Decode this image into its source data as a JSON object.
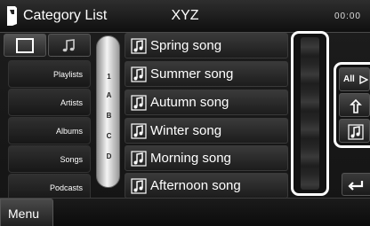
{
  "header": {
    "title": "Category List",
    "source": "XYZ",
    "clock": "00:00"
  },
  "mode_tabs": [
    {
      "icon": "list-view-icon"
    },
    {
      "icon": "music-note-icon"
    }
  ],
  "categories": [
    "Playlists",
    "Artists",
    "Albums",
    "Songs",
    "Podcasts"
  ],
  "alphabet_index": [
    "1",
    "A",
    "B",
    "C",
    "D"
  ],
  "songs": [
    "Spring song",
    "Summer song",
    "Autumn song",
    "Winter song",
    "Morning song",
    "Afternoon song"
  ],
  "function_buttons": {
    "all_label": "All",
    "icons": [
      "play-arrow-icon",
      "up-folder-icon",
      "current-track-icon"
    ]
  },
  "return_icon": "return-icon",
  "bottom": {
    "menu_label": "Menu"
  },
  "colors": {
    "background": "#141414",
    "highlight_frame": "#ffffff",
    "index_strip": "#e6e6e6"
  }
}
